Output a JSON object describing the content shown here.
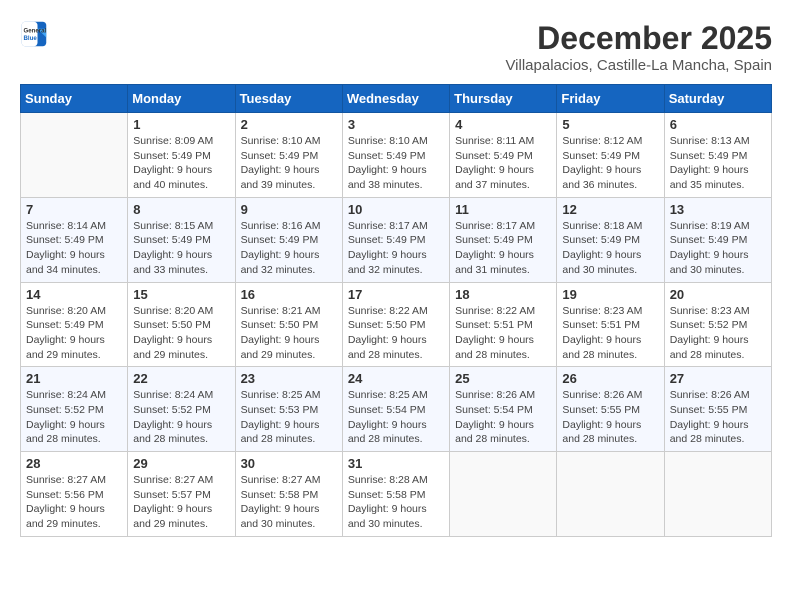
{
  "logo": {
    "line1": "General",
    "line2": "Blue"
  },
  "title": "December 2025",
  "subtitle": "Villapalacios, Castille-La Mancha, Spain",
  "days_of_week": [
    "Sunday",
    "Monday",
    "Tuesday",
    "Wednesday",
    "Thursday",
    "Friday",
    "Saturday"
  ],
  "weeks": [
    [
      {
        "day": "",
        "sunrise": "",
        "sunset": "",
        "daylight": ""
      },
      {
        "day": "1",
        "sunrise": "8:09 AM",
        "sunset": "5:49 PM",
        "daylight": "9 hours and 40 minutes."
      },
      {
        "day": "2",
        "sunrise": "8:10 AM",
        "sunset": "5:49 PM",
        "daylight": "9 hours and 39 minutes."
      },
      {
        "day": "3",
        "sunrise": "8:10 AM",
        "sunset": "5:49 PM",
        "daylight": "9 hours and 38 minutes."
      },
      {
        "day": "4",
        "sunrise": "8:11 AM",
        "sunset": "5:49 PM",
        "daylight": "9 hours and 37 minutes."
      },
      {
        "day": "5",
        "sunrise": "8:12 AM",
        "sunset": "5:49 PM",
        "daylight": "9 hours and 36 minutes."
      },
      {
        "day": "6",
        "sunrise": "8:13 AM",
        "sunset": "5:49 PM",
        "daylight": "9 hours and 35 minutes."
      }
    ],
    [
      {
        "day": "7",
        "sunrise": "8:14 AM",
        "sunset": "5:49 PM",
        "daylight": "9 hours and 34 minutes."
      },
      {
        "day": "8",
        "sunrise": "8:15 AM",
        "sunset": "5:49 PM",
        "daylight": "9 hours and 33 minutes."
      },
      {
        "day": "9",
        "sunrise": "8:16 AM",
        "sunset": "5:49 PM",
        "daylight": "9 hours and 32 minutes."
      },
      {
        "day": "10",
        "sunrise": "8:17 AM",
        "sunset": "5:49 PM",
        "daylight": "9 hours and 32 minutes."
      },
      {
        "day": "11",
        "sunrise": "8:17 AM",
        "sunset": "5:49 PM",
        "daylight": "9 hours and 31 minutes."
      },
      {
        "day": "12",
        "sunrise": "8:18 AM",
        "sunset": "5:49 PM",
        "daylight": "9 hours and 30 minutes."
      },
      {
        "day": "13",
        "sunrise": "8:19 AM",
        "sunset": "5:49 PM",
        "daylight": "9 hours and 30 minutes."
      }
    ],
    [
      {
        "day": "14",
        "sunrise": "8:20 AM",
        "sunset": "5:49 PM",
        "daylight": "9 hours and 29 minutes."
      },
      {
        "day": "15",
        "sunrise": "8:20 AM",
        "sunset": "5:50 PM",
        "daylight": "9 hours and 29 minutes."
      },
      {
        "day": "16",
        "sunrise": "8:21 AM",
        "sunset": "5:50 PM",
        "daylight": "9 hours and 29 minutes."
      },
      {
        "day": "17",
        "sunrise": "8:22 AM",
        "sunset": "5:50 PM",
        "daylight": "9 hours and 28 minutes."
      },
      {
        "day": "18",
        "sunrise": "8:22 AM",
        "sunset": "5:51 PM",
        "daylight": "9 hours and 28 minutes."
      },
      {
        "day": "19",
        "sunrise": "8:23 AM",
        "sunset": "5:51 PM",
        "daylight": "9 hours and 28 minutes."
      },
      {
        "day": "20",
        "sunrise": "8:23 AM",
        "sunset": "5:52 PM",
        "daylight": "9 hours and 28 minutes."
      }
    ],
    [
      {
        "day": "21",
        "sunrise": "8:24 AM",
        "sunset": "5:52 PM",
        "daylight": "9 hours and 28 minutes."
      },
      {
        "day": "22",
        "sunrise": "8:24 AM",
        "sunset": "5:52 PM",
        "daylight": "9 hours and 28 minutes."
      },
      {
        "day": "23",
        "sunrise": "8:25 AM",
        "sunset": "5:53 PM",
        "daylight": "9 hours and 28 minutes."
      },
      {
        "day": "24",
        "sunrise": "8:25 AM",
        "sunset": "5:54 PM",
        "daylight": "9 hours and 28 minutes."
      },
      {
        "day": "25",
        "sunrise": "8:26 AM",
        "sunset": "5:54 PM",
        "daylight": "9 hours and 28 minutes."
      },
      {
        "day": "26",
        "sunrise": "8:26 AM",
        "sunset": "5:55 PM",
        "daylight": "9 hours and 28 minutes."
      },
      {
        "day": "27",
        "sunrise": "8:26 AM",
        "sunset": "5:55 PM",
        "daylight": "9 hours and 28 minutes."
      }
    ],
    [
      {
        "day": "28",
        "sunrise": "8:27 AM",
        "sunset": "5:56 PM",
        "daylight": "9 hours and 29 minutes."
      },
      {
        "day": "29",
        "sunrise": "8:27 AM",
        "sunset": "5:57 PM",
        "daylight": "9 hours and 29 minutes."
      },
      {
        "day": "30",
        "sunrise": "8:27 AM",
        "sunset": "5:58 PM",
        "daylight": "9 hours and 30 minutes."
      },
      {
        "day": "31",
        "sunrise": "8:28 AM",
        "sunset": "5:58 PM",
        "daylight": "9 hours and 30 minutes."
      },
      {
        "day": "",
        "sunrise": "",
        "sunset": "",
        "daylight": ""
      },
      {
        "day": "",
        "sunrise": "",
        "sunset": "",
        "daylight": ""
      },
      {
        "day": "",
        "sunrise": "",
        "sunset": "",
        "daylight": ""
      }
    ]
  ]
}
